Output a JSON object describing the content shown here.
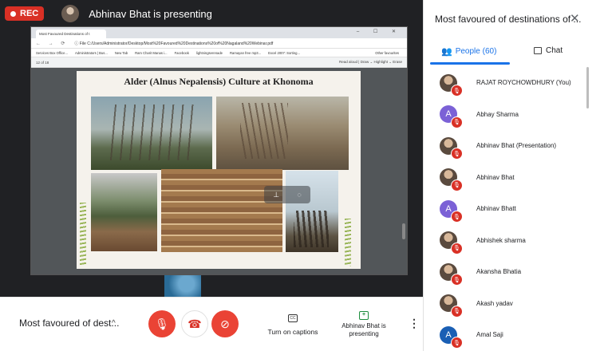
{
  "recording": {
    "label": "REC"
  },
  "presenter": {
    "title": "Abhinav Bhat is presenting"
  },
  "browser": {
    "tab_title": "Most Favoured Destinations of t",
    "window_controls": "– ☐ ✕",
    "nav": "← → ⟳",
    "url": "ⓘ File  C:/Users/Administrator/Desktop/Most%20Favoured%20Destinations%20of%20Nagaland%20Webinar.pdf",
    "bookmarks": [
      "Services Box Office...",
      "Administrators | Bus...",
      "New Tab",
      "Ram Charit Manas i...",
      "Facebook",
      "lightningserenade",
      "Ramayan free mp3...",
      "Excel 2007: Sorting..."
    ],
    "bookmarks_right": "Other favourites",
    "pdf_page": "12  of 18",
    "pdf_tools": "Read aloud  |  Draw  ⌄  Highlight  ⌄  Erase"
  },
  "slide": {
    "title": "Alder (Alnus Nepalensis) Culture at Khonoma"
  },
  "controls": {
    "meeting_title": "Most favoured of dest...",
    "caret": "^",
    "mic_icon": "🎙",
    "end_icon": "☎",
    "cam_icon": "⊘",
    "cc_icon": "CC",
    "caption_label": "Turn on captions",
    "present_icon": "+",
    "present_label": "Abhinav Bhat is presenting",
    "more_icon": "⋮"
  },
  "panel": {
    "title": "Most favoured of destinations of ...",
    "close": "✕",
    "tab_people": "People (60)",
    "tab_chat": "Chat",
    "participants": [
      {
        "name": "RAJAT ROYCHOWDHURY (You)",
        "avatar": "",
        "type": "photo"
      },
      {
        "name": "Abhay Sharma",
        "avatar": "A",
        "type": "letter"
      },
      {
        "name": "Abhinav Bhat (Presentation)",
        "avatar": "",
        "type": "photo"
      },
      {
        "name": "Abhinav Bhat",
        "avatar": "",
        "type": "photo"
      },
      {
        "name": "Abhinav Bhatt",
        "avatar": "A",
        "type": "letter"
      },
      {
        "name": "Abhishek sharma",
        "avatar": "",
        "type": "photo"
      },
      {
        "name": "Akansha Bhatia",
        "avatar": "",
        "type": "photo"
      },
      {
        "name": "Akash yadav",
        "avatar": "",
        "type": "photo"
      },
      {
        "name": "Amal Saji",
        "avatar": "A",
        "type": "blue"
      }
    ]
  }
}
